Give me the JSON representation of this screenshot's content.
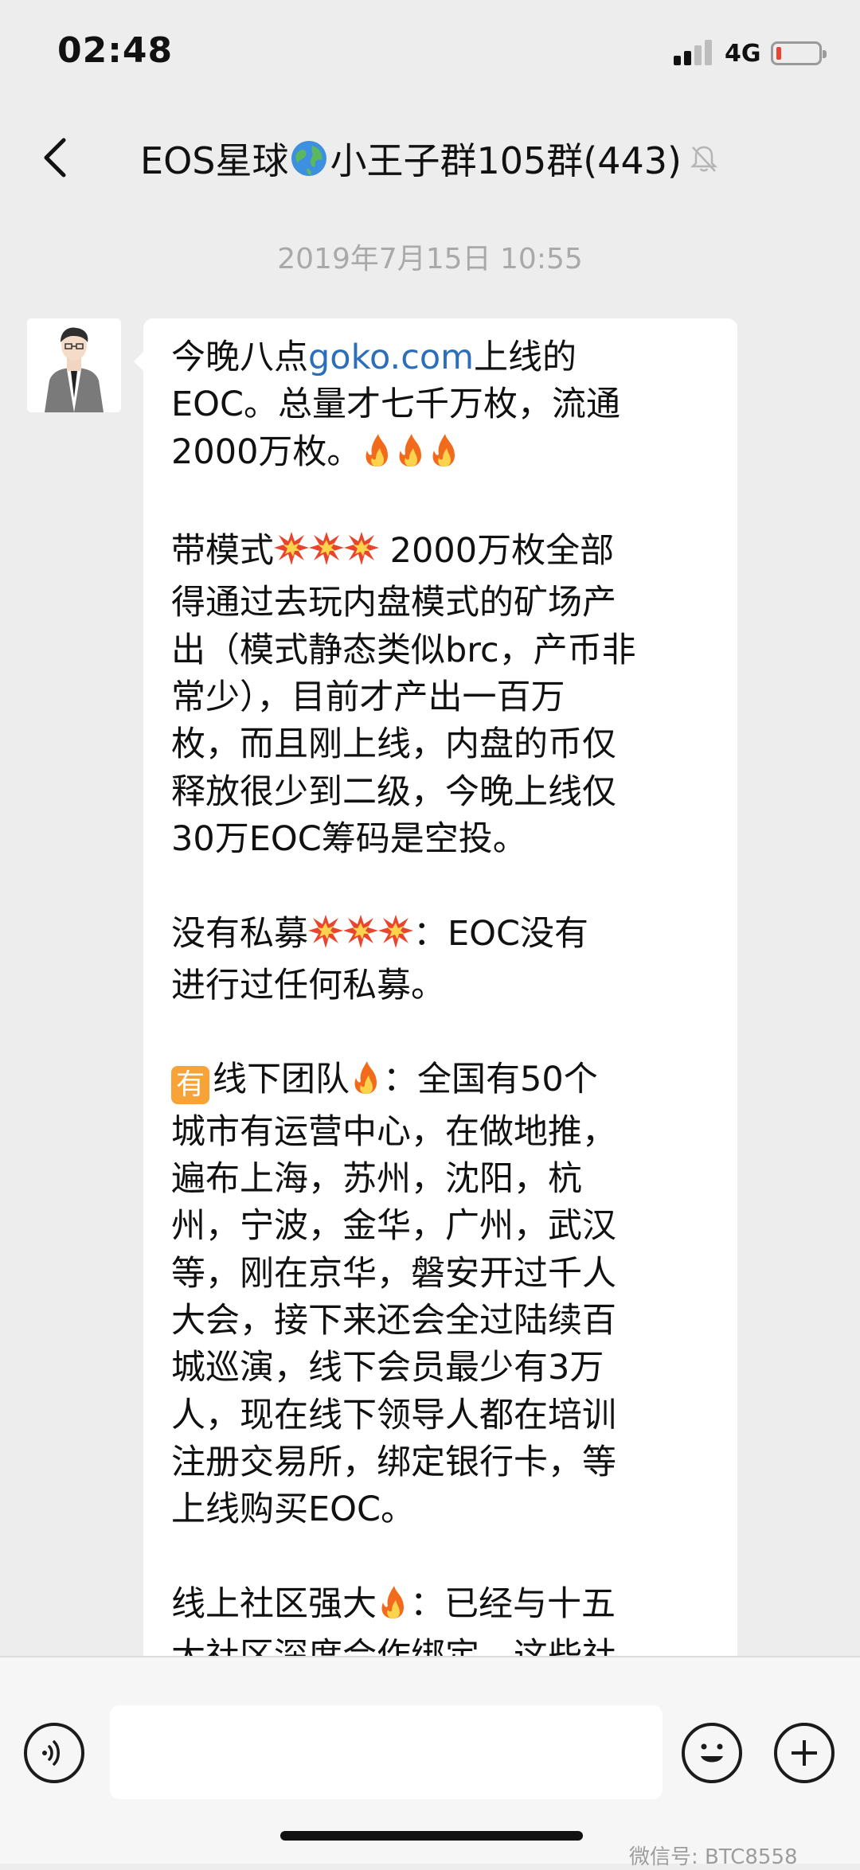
{
  "status_bar": {
    "time": "02:48",
    "network": "4G",
    "battery_level": 0.12
  },
  "header": {
    "title_part1": "EOS星球",
    "globe_icon": "globe-icon",
    "title_part2": "小王子群105群(443)",
    "mute_icon": "bell-off-icon"
  },
  "chat": {
    "timestamp": "2019年7月15日 10:55",
    "message": {
      "p1_a": "今晚八点",
      "p1_link": "goko.com",
      "p1_b": "上线的\nEOC。总量才七千万枚，流通\n2000万枚。",
      "p2_a": "带模式",
      "p2_b": " 2000万枚全部\n得通过去玩内盘模式的矿场产\n出（模式静态类似brc，产币非\n常少），目前才产出一百万\n枚，而且刚上线，内盘的币仅\n释放很少到二级，今晚上线仅\n30万EOC筹码是空投。",
      "p3_a": "没有私募",
      "p3_b": "：EOC没有\n进行过任何私募。",
      "p4_badge": "有",
      "p4_a": "线下团队",
      "p4_b": "：全国有50个\n城市有运营中心，在做地推，\n遍布上海，苏州，沈阳，杭\n州，宁波，金华，广州，武汉\n等，刚在京华，磐安开过千人\n大会，接下来还会全过陆续百\n城巡演，线下会员最少有3万\n人，现在线下领导人都在培训\n注册交易所，绑定银行卡，等\n上线购买EOC。",
      "p5_a": "线上社区强大",
      "p5_b": "：已经与十五\n大社区深度合作绑定，这些社"
    }
  },
  "input_bar": {
    "voice_icon": "voice-icon",
    "emoji_icon": "smiley-icon",
    "plus_icon": "plus-icon"
  },
  "watermark": "微信号: BTC8558",
  "colors": {
    "background": "#ededed",
    "bubble": "#ffffff",
    "link": "#2c6fb8",
    "badge": "#f8a338"
  }
}
